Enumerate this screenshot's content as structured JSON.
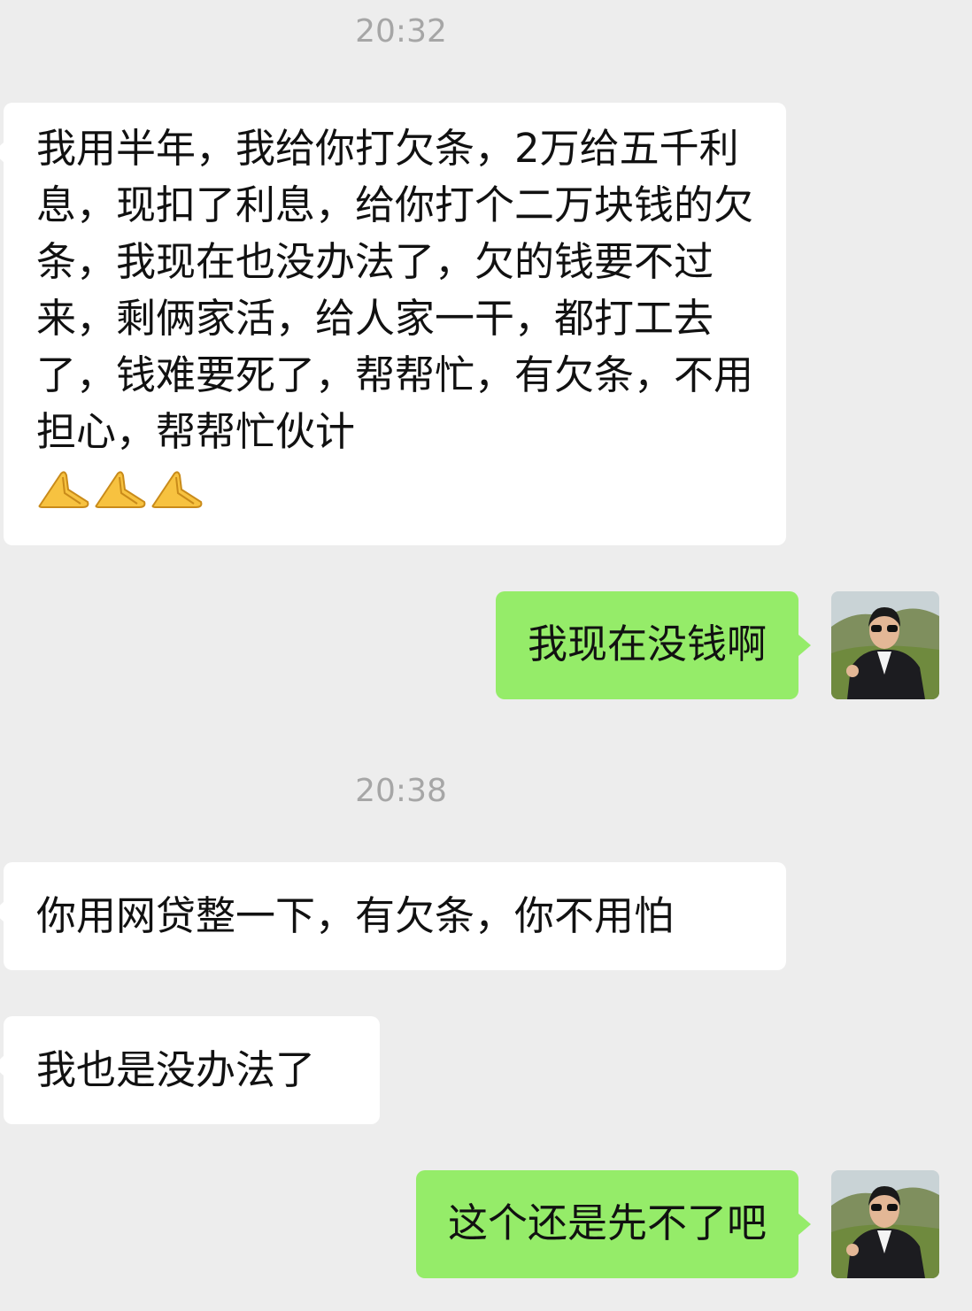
{
  "chat": {
    "timestamps": [
      "20:32",
      "20:38"
    ],
    "messages": [
      {
        "side": "incoming",
        "text": "我用半年，我给你打欠条，2万给五千利息，现扣了利息，给你打个二万块钱的欠条，我现在也没办法了，欠的钱要不过来，剩俩家活，给人家一干，都打工去了，钱难要死了，帮帮忙，有欠条，不用担心，帮帮忙伙计",
        "emoji": [
          "praying-hands-emoji",
          "praying-hands-emoji",
          "praying-hands-emoji"
        ]
      },
      {
        "side": "outgoing",
        "text": "我现在没钱啊"
      },
      {
        "side": "incoming",
        "text": "你用网贷整一下，有欠条，你不用怕"
      },
      {
        "side": "incoming",
        "text": "我也是没办法了"
      },
      {
        "side": "outgoing",
        "text": "这个还是先不了吧"
      }
    ]
  },
  "colors": {
    "background": "#ededed",
    "incoming_bubble": "#ffffff",
    "outgoing_bubble": "#95ec69",
    "timestamp": "#a6a6a6"
  }
}
